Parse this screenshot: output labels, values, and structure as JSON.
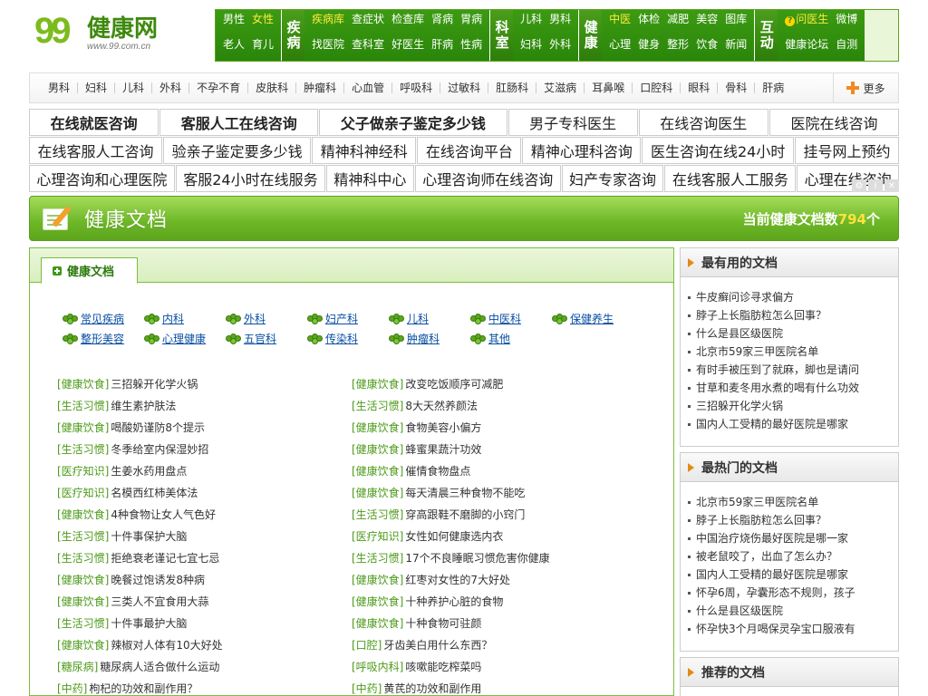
{
  "logo": {
    "number": "99",
    "name": "健康网",
    "url": "www.99.com.cn"
  },
  "topnav": {
    "group1": {
      "links": [
        [
          "男性",
          "女性"
        ],
        [
          "老人",
          "育儿"
        ]
      ]
    },
    "group2": {
      "tag": "疾病",
      "links": [
        [
          "疾病库",
          "查症状",
          "检查库",
          "肾病",
          "胃病"
        ],
        [
          "找医院",
          "查科室",
          "好医生",
          "肝病",
          "性病"
        ]
      ]
    },
    "group3": {
      "tag": "科室",
      "links": [
        [
          "儿科",
          "男科"
        ],
        [
          "妇科",
          "外科"
        ]
      ]
    },
    "group4": {
      "tag": "健康",
      "links": [
        [
          "中医",
          "体检",
          "减肥",
          "美容",
          "图库"
        ],
        [
          "心理",
          "健身",
          "整形",
          "饮食",
          "新闻"
        ]
      ]
    },
    "group5": {
      "tag": "互动",
      "links": [
        [
          "问医生",
          "微博"
        ],
        [
          "健康论坛",
          "自测"
        ]
      ]
    }
  },
  "deptbar": {
    "items": [
      "男科",
      "妇科",
      "儿科",
      "外科",
      "不孕不育",
      "皮肤科",
      "肿瘤科",
      "心血管",
      "呼吸科",
      "过敏科",
      "肛肠科",
      "艾滋病",
      "耳鼻喉",
      "口腔科",
      "眼科",
      "骨科",
      "肝病"
    ],
    "more": "更多"
  },
  "ads": {
    "row1": [
      "在线就医咨询",
      "客服人工在线咨询",
      "父子做亲子鉴定多少钱",
      "男子专科医生",
      "在线咨询医生",
      "医院在线咨询"
    ],
    "row2": [
      "在线客服人工咨询",
      "验亲子鉴定要多少钱",
      "精神科神经科",
      "在线咨询平台",
      "精神心理科咨询",
      "医生咨询在线24小时",
      "挂号网上预约"
    ],
    "row3": [
      "心理咨询和心理医院",
      "客服24小时在线服务",
      "精神科中心",
      "心理咨询师在线咨询",
      "妇产专家咨询",
      "在线客服人工服务",
      "心理在线咨询"
    ]
  },
  "banner": {
    "title": "健康文档",
    "count_prefix": "当前健康文档数",
    "count": "794",
    "count_suffix": "个"
  },
  "main": {
    "tab": "健康文档",
    "categories": [
      "常见疾病",
      "内科",
      "外科",
      "妇产科",
      "儿科",
      "中医科",
      "保健养生",
      "整形美容",
      "心理健康",
      "五官科",
      "传染科",
      "肿瘤科",
      "其他"
    ],
    "docs": [
      [
        "[健康饮食]",
        "三招躲开化学火锅"
      ],
      [
        "[健康饮食]",
        "改变吃饭顺序可减肥"
      ],
      [
        "[生活习惯]",
        "维生素护肤法"
      ],
      [
        "[生活习惯]",
        "8大天然养颜法"
      ],
      [
        "[健康饮食]",
        "喝酸奶谨防8个提示"
      ],
      [
        "[健康饮食]",
        "食物美容小偏方"
      ],
      [
        "[生活习惯]",
        "冬季给室内保湿妙招"
      ],
      [
        "[健康饮食]",
        "蜂蜜果蔬汁功效"
      ],
      [
        "[医疗知识]",
        "生姜水药用盘点"
      ],
      [
        "[健康饮食]",
        "催情食物盘点"
      ],
      [
        "[医疗知识]",
        "名模西红柿美体法"
      ],
      [
        "[健康饮食]",
        "每天清晨三种食物不能吃"
      ],
      [
        "[健康饮食]",
        "4种食物让女人气色好"
      ],
      [
        "[生活习惯]",
        "穿高跟鞋不磨脚的小窍门"
      ],
      [
        "[生活习惯]",
        "十件事保护大脑"
      ],
      [
        "[医疗知识]",
        "女性如何健康选内衣"
      ],
      [
        "[生活习惯]",
        "拒绝衰老谨记七宜七忌"
      ],
      [
        "[生活习惯]",
        "17个不良睡眠习惯危害你健康"
      ],
      [
        "[健康饮食]",
        "晚餐过饱诱发8种病"
      ],
      [
        "[健康饮食]",
        "红枣对女性的7大好处"
      ],
      [
        "[健康饮食]",
        "三类人不宜食用大蒜"
      ],
      [
        "[健康饮食]",
        "十种养护心脏的食物"
      ],
      [
        "[生活习惯]",
        "十件事最护大脑"
      ],
      [
        "[健康饮食]",
        "十种食物可驻颜"
      ],
      [
        "[健康饮食]",
        "辣椒对人体有10大好处"
      ],
      [
        "[口腔]",
        "牙齿美白用什么东西？"
      ],
      [
        "[糖尿病]",
        "糖尿病人适合做什么运动"
      ],
      [
        "[呼吸内科]",
        "咳嗽能吃榨菜吗"
      ],
      [
        "[中药]",
        "枸杞的功效和副作用？"
      ],
      [
        "[中药]",
        "黄芪的功效和副作用"
      ]
    ]
  },
  "sidebar": {
    "useful": {
      "title": "最有用的文档",
      "items": [
        "牛皮癣问诊寻求偏方",
        "脖子上长脂肪粒怎么回事？",
        "什么是县区级医院",
        "北京市59家三甲医院名单",
        "有时手被压到了就麻，脚也是请问",
        "甘草和麦冬用水煮的喝有什么功效",
        "三招躲开化学火锅",
        "国内人工受精的最好医院是哪家"
      ]
    },
    "popular": {
      "title": "最热门的文档",
      "items": [
        "北京市59家三甲医院名单",
        "脖子上长脂肪粒怎么回事？",
        "中国治疗烧伤最好医院是哪一家",
        "被老鼠咬了，出血了怎么办？",
        "国内人工受精的最好医院是哪家",
        "怀孕6周，孕囊形态不规则，孩子",
        "什么是县区级医院",
        "怀孕快3个月喝保灵孕宝口服液有"
      ]
    },
    "recommend": {
      "title": "推荐的文档"
    }
  }
}
